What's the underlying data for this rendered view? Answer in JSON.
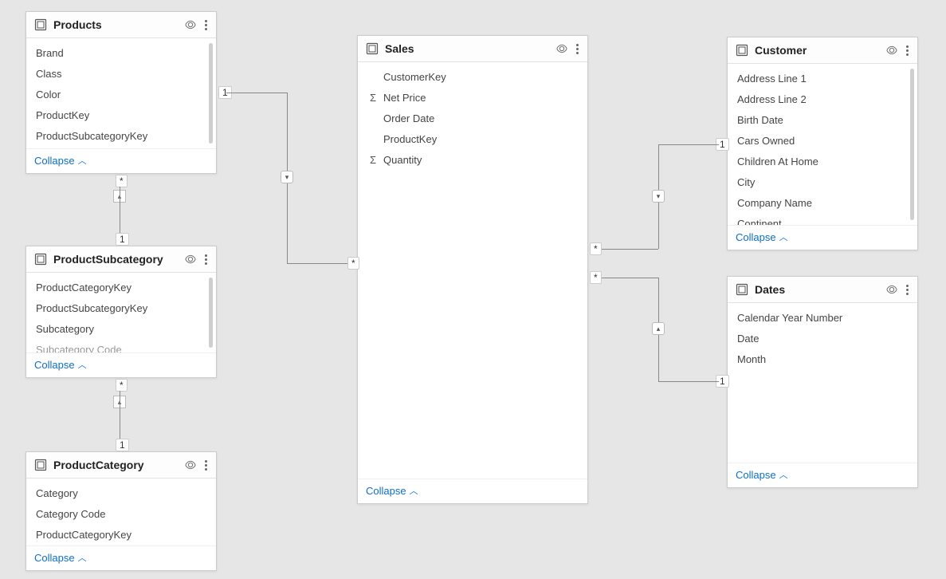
{
  "collapse_label": "Collapse",
  "tables": {
    "products": {
      "title": "Products",
      "fields": [
        {
          "name": "Brand"
        },
        {
          "name": "Class"
        },
        {
          "name": "Color"
        },
        {
          "name": "ProductKey"
        },
        {
          "name": "ProductSubcategoryKey"
        }
      ]
    },
    "productSubcategory": {
      "title": "ProductSubcategory",
      "fields": [
        {
          "name": "ProductCategoryKey"
        },
        {
          "name": "ProductSubcategoryKey"
        },
        {
          "name": "Subcategory"
        },
        {
          "name": "Subcategory Code",
          "faded": true
        }
      ]
    },
    "productCategory": {
      "title": "ProductCategory",
      "fields": [
        {
          "name": "Category"
        },
        {
          "name": "Category Code"
        },
        {
          "name": "ProductCategoryKey"
        }
      ]
    },
    "sales": {
      "title": "Sales",
      "fields": [
        {
          "name": "CustomerKey"
        },
        {
          "name": "Net Price",
          "agg": true
        },
        {
          "name": "Order Date"
        },
        {
          "name": "ProductKey"
        },
        {
          "name": "Quantity",
          "agg": true
        }
      ]
    },
    "customer": {
      "title": "Customer",
      "fields": [
        {
          "name": "Address Line 1"
        },
        {
          "name": "Address Line 2"
        },
        {
          "name": "Birth Date"
        },
        {
          "name": "Cars Owned"
        },
        {
          "name": "Children At Home"
        },
        {
          "name": "City"
        },
        {
          "name": "Company Name"
        },
        {
          "name": "Continent"
        }
      ]
    },
    "dates": {
      "title": "Dates",
      "fields": [
        {
          "name": "Calendar Year Number"
        },
        {
          "name": "Date"
        },
        {
          "name": "Month"
        }
      ]
    }
  },
  "relationships": [
    {
      "from": "products",
      "to": "sales",
      "from_card": "1",
      "to_card": "*"
    },
    {
      "from": "productSubcategory",
      "to": "products",
      "from_card": "1",
      "to_card": "*"
    },
    {
      "from": "productCategory",
      "to": "productSubcategory",
      "from_card": "1",
      "to_card": "*"
    },
    {
      "from": "customer",
      "to": "sales",
      "from_card": "1",
      "to_card": "*"
    },
    {
      "from": "dates",
      "to": "sales",
      "from_card": "1",
      "to_card": "*"
    }
  ],
  "cardinality": {
    "one": "1",
    "many": "*"
  }
}
